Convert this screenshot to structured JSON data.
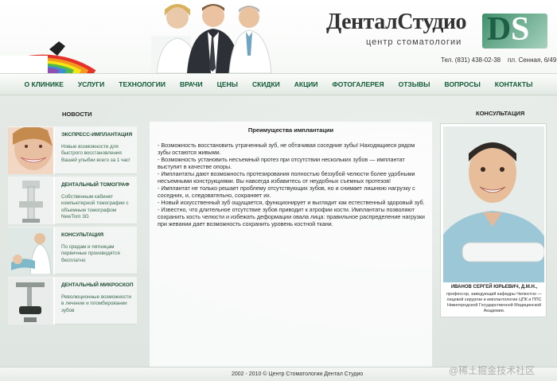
{
  "header": {
    "logo_title": "ДенталСтудио",
    "logo_subtitle": "центр стоматологии",
    "phone": "Тел. (831) 438-02-38",
    "address": "пл. Сенная, 6/49"
  },
  "nav": {
    "items": [
      "О КЛИНИКЕ",
      "УСЛУГИ",
      "ТЕХНОЛОГИИ",
      "ВРАЧИ",
      "ЦЕНЫ",
      "СКИДКИ",
      "АКЦИИ",
      "ФОТОГАЛЕРЕЯ",
      "ОТЗЫВЫ",
      "ВОПРОСЫ",
      "КОНТАКТЫ"
    ]
  },
  "news": {
    "heading": "НОВОСТИ",
    "items": [
      {
        "title": "ЭКСПРЕСС-ИМПЛАНТАЦИЯ",
        "text": "Новые возможности для быстрого восстановления Вашей улыбки всего за 1 час!"
      },
      {
        "title": "ДЕНТАЛЬНЫЙ ТОМОГРАФ",
        "text": "Собственным кабинет компьютерной томографии с объемным томографом NewTom 3G"
      },
      {
        "title": "КОНСУЛЬТАЦИЯ",
        "text": "По средам и пятницам первичные производятся бесплатно"
      },
      {
        "title": "ДЕНТАЛЬНЫЙ МИКРОСКОП",
        "text": "Революционные возможности в лечении и пломбировании зубов"
      }
    ]
  },
  "article": {
    "title": "Преимущества имплантации",
    "paragraphs": [
      "- Возможность восстановить утраченный зуб, не обтачивая соседние зубы! Находящиеся рядом зубы остаются живыми.",
      "- Возможность установить несъемный протез при отсутствии нескольких зубов — имплантат выступит в качестве опоры.",
      "- Имплантаты дают возможность протезирования полностью беззубой челюсти более удобными несъемными конструкциями. Вы навсегда избавитесь от неудобных съемных протезов!",
      "- Имплантат не только решает проблему отсутствующих зубов, но и снимает лишнюю нагрузку с соседних, и, следовательно, сохраняет их.",
      "- Новый искусственный зуб ощущается, функционирует и выглядит как естественный здоровый зуб.",
      "- Известно, что длительное отсутствие зубов приводит к атрофии кости. Имплантаты позволяют сохранить кость челюсти и избежать деформации овала лица: правильное распределение нагрузки при жевании дает возможность сохранить уровень костной ткани."
    ]
  },
  "consultation": {
    "heading": "КОНСУЛЬТАЦИЯ",
    "name": "ИВАНОВ СЕРГЕЙ ЮРЬЕВИЧ, Д.М.Н.,",
    "description": "профессор, заведующий кафедры Челюстно — лицевой хирургии и имплантологии ЦПК и ППС Нижегородской Государственной Медицинской Академии."
  },
  "footer": {
    "copyright": "2002 - 2010 © Центр Стоматологии Дентал Студио"
  },
  "watermark": "@稀土掘金技术社区",
  "colors": {
    "nav_text": "#0f5a35",
    "accent_green": "#3f8f6c",
    "page_bg": "#e9eeea"
  }
}
